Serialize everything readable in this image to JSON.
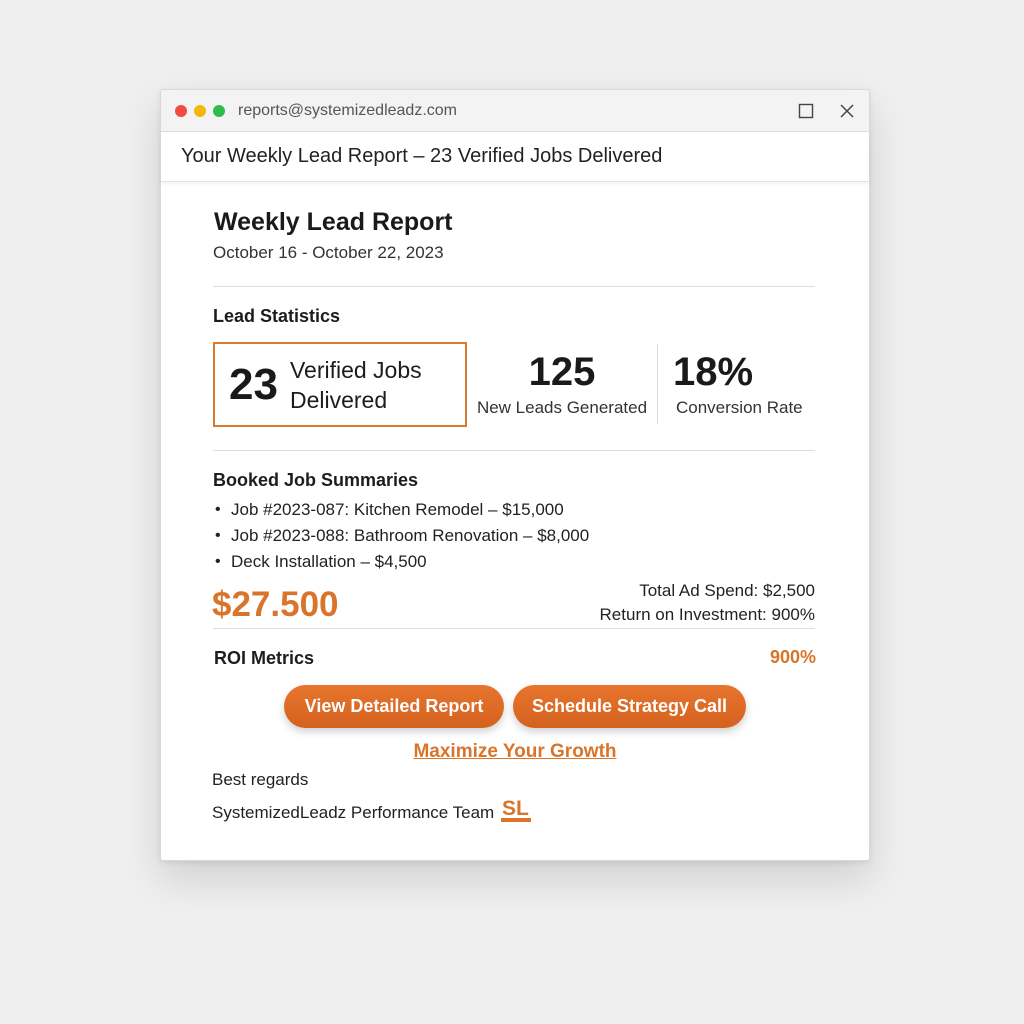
{
  "window": {
    "sender": "reports@systemizedleadz.com",
    "subject": "Your Weekly Lead Report – 23 Verified Jobs Delivered"
  },
  "report": {
    "title": "Weekly Lead Report",
    "date_range": "October 16 - October 22, 2023"
  },
  "lead_statistics": {
    "heading": "Lead Statistics",
    "highlight": {
      "value": "23",
      "label_line1": "Verified Jobs",
      "label_line2": "Delivered"
    },
    "new_leads": {
      "value": "125",
      "label": "New Leads Generated"
    },
    "conversion": {
      "value": "18%",
      "label": "Conversion Rate"
    }
  },
  "booked_jobs": {
    "heading": "Booked Job Summaries",
    "items": [
      "Job #2023-087: Kitchen Remodel – $15,000",
      "Job #2023-088: Bathroom Renovation – $8,000",
      "Deck Installation – $4,500"
    ]
  },
  "totals": {
    "total_value": "$27.500",
    "ad_spend": "Total Ad Spend: $2,500",
    "roi_line": "Return on Investment: 900%"
  },
  "roi": {
    "heading": "ROI Metrics",
    "percent": "900%"
  },
  "actions": {
    "view_report": "View Detailed Report",
    "schedule_call": "Schedule Strategy Call",
    "growth_link": "Maximize Your Growth"
  },
  "signature": {
    "closing": "Best regards",
    "team": "SystemizedLeadz Performance Team",
    "logo_text": "SL"
  },
  "colors": {
    "accent": "#d9742a",
    "traffic_red": "#ee4d3f",
    "traffic_yellow": "#f3b70e",
    "traffic_green": "#2fbc4b"
  },
  "icons": {
    "maximize": "maximize-icon",
    "close": "close-icon",
    "logo": "systemizedleadz-logo-icon"
  }
}
